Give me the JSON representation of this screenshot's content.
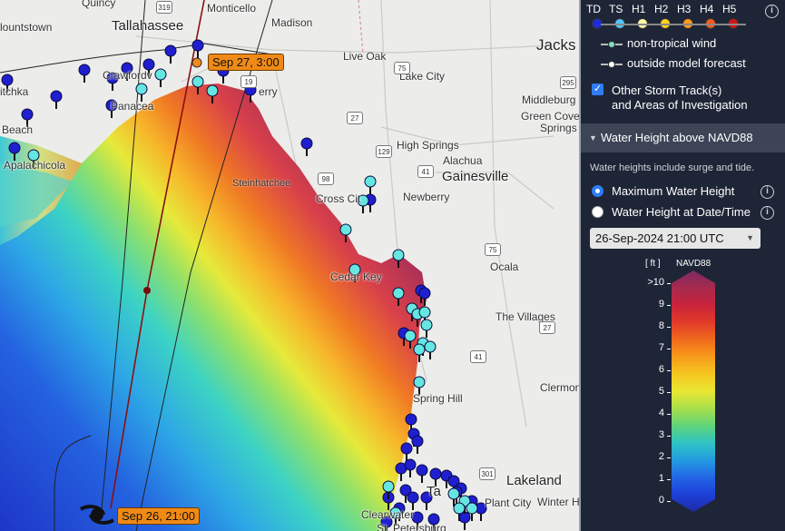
{
  "map": {
    "places": [
      {
        "key": "quincy",
        "text": "Quincy"
      },
      {
        "key": "monticello",
        "text": "Monticello"
      },
      {
        "key": "tallahassee",
        "text": "Tallahassee"
      },
      {
        "key": "bountstown",
        "text": "lountstown"
      },
      {
        "key": "madison",
        "text": "Madison"
      },
      {
        "key": "jacks",
        "text": "Jacks"
      },
      {
        "key": "liveoak",
        "text": "Live Oak"
      },
      {
        "key": "lakecity",
        "text": "Lake City"
      },
      {
        "key": "crawfordville",
        "text": "Crawfordv"
      },
      {
        "key": "wewahitchka",
        "text": "itchka"
      },
      {
        "key": "panacea",
        "text": "Panacea"
      },
      {
        "key": "perry",
        "text": "erry"
      },
      {
        "key": "middleburg",
        "text": "Middleburg"
      },
      {
        "key": "greencove",
        "text": "Green Cove"
      },
      {
        "key": "springs",
        "text": "Springs"
      },
      {
        "key": "beach",
        "text": "Beach"
      },
      {
        "key": "apalachicola",
        "text": "Apalachicola"
      },
      {
        "key": "highsprings",
        "text": "High Springs"
      },
      {
        "key": "alachua",
        "text": "Alachua"
      },
      {
        "key": "gainesville",
        "text": "Gainesville"
      },
      {
        "key": "steinhatchee",
        "text": "Steinhatchee"
      },
      {
        "key": "crosscity",
        "text": "Cross Cit"
      },
      {
        "key": "newberry",
        "text": "Newberry"
      },
      {
        "key": "cedarkey",
        "text": "Cedar Key"
      },
      {
        "key": "ocala",
        "text": "Ocala"
      },
      {
        "key": "thevillages",
        "text": "The Villages"
      },
      {
        "key": "clermont",
        "text": "Clermon"
      },
      {
        "key": "springhill",
        "text": "Spring Hill"
      },
      {
        "key": "lakeland",
        "text": "Lakeland"
      },
      {
        "key": "plantcity",
        "text": "Plant City"
      },
      {
        "key": "winterh",
        "text": "Winter H"
      },
      {
        "key": "tampa",
        "text": "Ta"
      },
      {
        "key": "clearwater",
        "text": "Clearwater"
      },
      {
        "key": "stpete",
        "text": "St. Petersburg"
      }
    ],
    "shields": [
      "319",
      "75",
      "19",
      "27",
      "129",
      "41",
      "98",
      "75",
      "41",
      "301",
      "295",
      "27"
    ],
    "time_labels": {
      "sep27": "Sep 27, 3:00",
      "sep26": "Sep 26, 21:00"
    }
  },
  "panel": {
    "categories": [
      "TD",
      "TS",
      "H1",
      "H2",
      "H3",
      "H4",
      "H5"
    ],
    "category_colors": [
      "#1f2bd8",
      "#4fc6ff",
      "#fff8a8",
      "#ffd11a",
      "#ff9b1a",
      "#ff5a1a",
      "#d21515"
    ],
    "legend_nontropical": "non-tropical wind",
    "legend_outside": "outside model forecast",
    "other_tracks_line1": "Other Storm Track(s)",
    "other_tracks_line2": "and Areas of Investigation",
    "section_title": "Water Height above NAVD88",
    "note": "Water heights include surge and tide.",
    "radio_max": "Maximum Water Height",
    "radio_date": "Water Height at Date/Time",
    "select_value": "26-Sep-2024 21:00 UTC",
    "scale_unit": "[ ft ]",
    "scale_datum": "NAVD88",
    "scale_ticks": [
      ">10",
      "9",
      "8",
      "7",
      "6",
      "5",
      "4",
      "3",
      "2",
      "1",
      "0"
    ],
    "scale_colors": [
      "#7d2a62",
      "#a62a4e",
      "#c8233a",
      "#e13a2a",
      "#f06a1d",
      "#f79a1b",
      "#f5c71f",
      "#e9e632",
      "#a8df4a",
      "#5fd47a",
      "#2fc4c4",
      "#239be0",
      "#2365e6",
      "#1d3ed6",
      "#1d2ca6"
    ]
  }
}
